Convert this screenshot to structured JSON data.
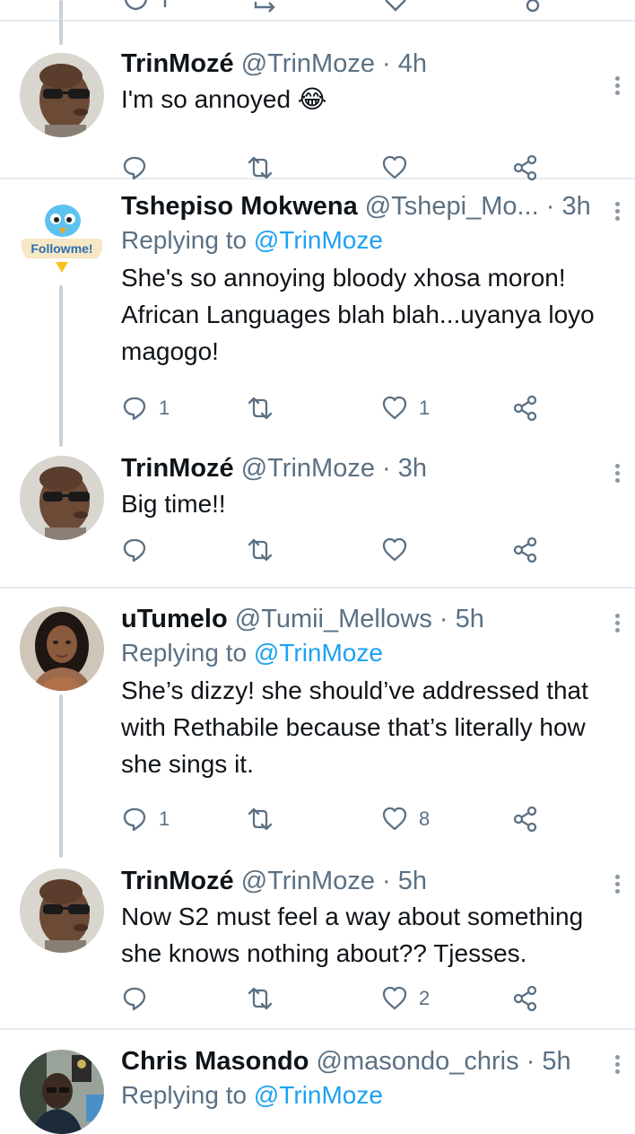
{
  "tweets": [
    {
      "name": "TrinMozé",
      "handle": "@TrinMoze",
      "time": "4h",
      "reply_label": "",
      "reply_mention": "",
      "text": "I'm so annoyed 😂",
      "replies": "",
      "likes": "",
      "avatar": "sunglasses-man"
    },
    {
      "name": "Tshepiso Mokwena",
      "handle": "@Tshepi_Mo...",
      "time": "3h",
      "reply_label": "Replying to",
      "reply_mention": "@TrinMoze",
      "text": "She's so annoying bloody xhosa moron! African Languages blah blah...uyanya loyo magogo!",
      "replies": "1",
      "likes": "1",
      "avatar": "followme-bird"
    },
    {
      "name": "TrinMozé",
      "handle": "@TrinMoze",
      "time": "3h",
      "reply_label": "",
      "reply_mention": "",
      "text": "Big time!!",
      "replies": "",
      "likes": "",
      "avatar": "sunglasses-man"
    },
    {
      "name": "uTumelo",
      "handle": "@Tumii_Mellows",
      "time": "5h",
      "reply_label": "Replying to",
      "reply_mention": "@TrinMoze",
      "text": "She’s dizzy! she should’ve addressed that with Rethabile because that’s literally how she sings it.",
      "replies": "1",
      "likes": "8",
      "avatar": "woman-portrait"
    },
    {
      "name": "TrinMozé",
      "handle": "@TrinMoze",
      "time": "5h",
      "reply_label": "",
      "reply_mention": "",
      "text": "Now S2 must feel a way about something she knows nothing about?? Tjesses.",
      "replies": "",
      "likes": "2",
      "avatar": "sunglasses-man"
    },
    {
      "name": "Chris Masondo",
      "handle": "@masondo_chris",
      "time": "5h",
      "reply_label": "Replying to",
      "reply_mention": "@TrinMoze",
      "text": "",
      "replies": "",
      "likes": "",
      "avatar": "man-studio"
    }
  ],
  "separator": " · ",
  "avatar_text": {
    "followme": "Followme!"
  },
  "colors": {
    "accent": "#1da1f2",
    "secondary_text": "#5b7083",
    "icon": "#5b7083",
    "divider": "#e6ecf0",
    "thread_line": "#c9d1d8"
  }
}
